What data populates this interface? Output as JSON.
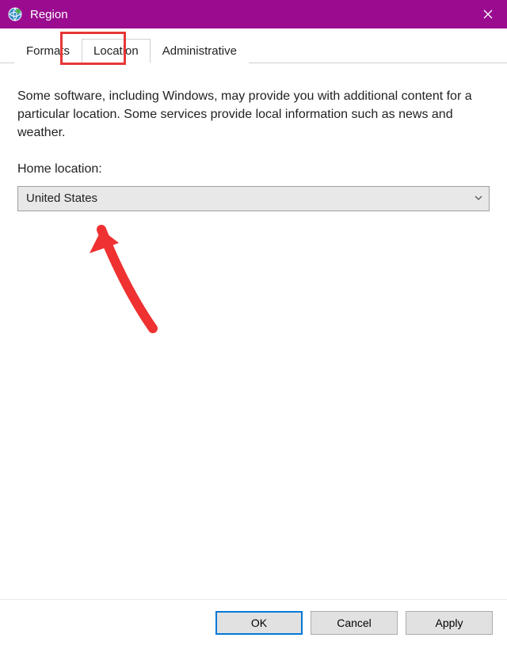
{
  "window": {
    "title": "Region"
  },
  "tabs": [
    {
      "label": "Formats",
      "active": false
    },
    {
      "label": "Location",
      "active": true
    },
    {
      "label": "Administrative",
      "active": false
    }
  ],
  "content": {
    "description": "Some software, including Windows, may provide you with additional content for a particular location. Some services provide local information such as news and weather.",
    "field_label": "Home location:",
    "dropdown_value": "United States"
  },
  "buttons": {
    "ok": "OK",
    "cancel": "Cancel",
    "apply": "Apply"
  }
}
